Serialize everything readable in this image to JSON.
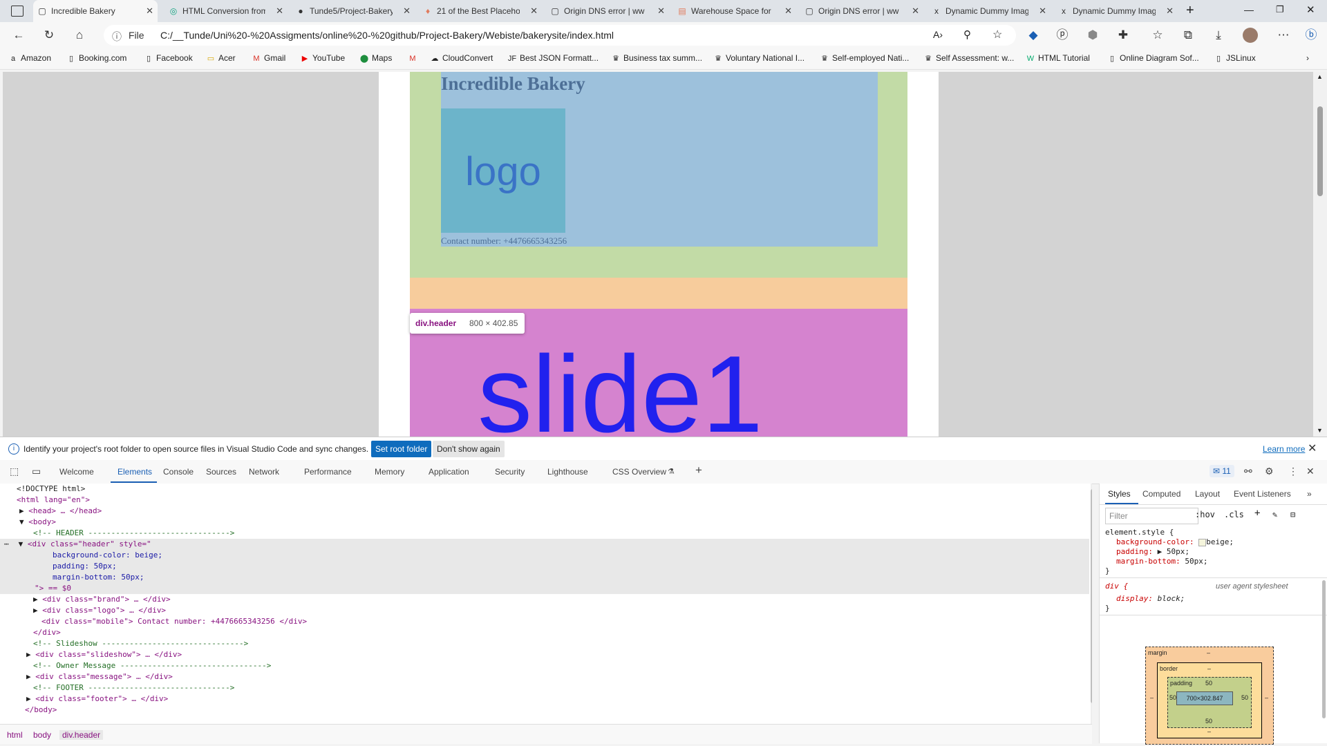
{
  "tabs": [
    {
      "label": "Incredible Bakery",
      "icon": "page-icon",
      "active": true
    },
    {
      "label": "HTML Conversion from",
      "icon": "chatgpt-icon"
    },
    {
      "label": "Tunde5/Project-Bakery",
      "icon": "github-icon"
    },
    {
      "label": "21 of the Best Placeho",
      "icon": "placeholder-site-icon"
    },
    {
      "label": "Origin DNS error | ww",
      "icon": "page-icon"
    },
    {
      "label": "Warehouse Space for",
      "icon": "warehouse-site-icon"
    },
    {
      "label": "Origin DNS error | ww",
      "icon": "page-icon"
    },
    {
      "label": "Dynamic Dummy Imag",
      "icon": "close-mark-icon"
    },
    {
      "label": "Dynamic Dummy Imag",
      "icon": "close-mark-icon"
    }
  ],
  "address": {
    "scheme_label": "File",
    "url": "C:/__Tunde/Uni%20-%20Assigments/online%20-%20github/Project-Bakery/Webiste/bakerysite/index.html"
  },
  "bookmarks": [
    "Amazon",
    "Booking.com",
    "Facebook",
    "Acer",
    "Gmail",
    "YouTube",
    "Maps",
    "CloudConvert",
    "Best JSON Formatt...",
    "Business tax summ...",
    "Voluntary National I...",
    "Self-employed Nati...",
    "Self Assessment: w...",
    "HTML Tutorial",
    "Online Diagram Sof...",
    "JSLinux"
  ],
  "page": {
    "title": "Incredible Bakery",
    "logo_text": "logo",
    "contact": "Contact number: +4476665343256",
    "slide_text": "slide1",
    "tooltip_tag": "div.header",
    "tooltip_size": "800 × 402.85",
    "colors": {
      "margin": "#c2dba6",
      "content": "#9dc1dc",
      "logo": "#6cb4ca",
      "margin_band": "#f7cc9c",
      "slide": "#d583cf"
    }
  },
  "infobar": {
    "message": "Identify your project's root folder to open source files in Visual Studio Code and sync changes.",
    "set_root": "Set root folder",
    "dont_show": "Don't show again",
    "learn_more": "Learn more"
  },
  "devtools": {
    "tabs": [
      "Welcome",
      "Elements",
      "Console",
      "Sources",
      "Network",
      "Performance",
      "Memory",
      "Application",
      "Security",
      "Lighthouse",
      "CSS Overview"
    ],
    "active_tab": "Elements",
    "issues_count": "11",
    "dom": {
      "doctype": "<!DOCTYPE html>",
      "html_open": "<html lang=\"en\">",
      "head": "<head> … </head>",
      "body_open": "<body>",
      "c_header": "<!-- HEADER ------------------------------->",
      "header_open": "<div class=\"header\" style=\"",
      "style1": "background-color: beige;",
      "style2": "padding: 50px;",
      "style3": "margin-bottom: 50px;",
      "style_close": "\"> == $0",
      "brand": "<div class=\"brand\"> … </div>",
      "logo": "<div class=\"logo\"> … </div>",
      "mobile": "<div class=\"mobile\"> Contact number: +4476665343256 </div>",
      "div_close": "</div>",
      "c_slideshow": "<!-- Slideshow ------------------------------->",
      "slideshow": "<div class=\"slideshow\"> … </div>",
      "c_owner": "<!-- Owner Message -------------------------------->",
      "message": "<div class=\"message\"> … </div>",
      "c_footer": "<!-- FOOTER ------------------------------->",
      "footer": "<div class=\"footer\"> … </div>",
      "body_close": "</body>"
    },
    "breadcrumbs": [
      "html",
      "body",
      "div.header"
    ]
  },
  "styles_pane": {
    "tabs": [
      "Styles",
      "Computed",
      "Layout",
      "Event Listeners"
    ],
    "filter_placeholder": "Filter",
    "hov": ":hov",
    "cls": ".cls",
    "element_style_selector": "element.style {",
    "p1": "background-color:",
    "v1": "beige;",
    "p2": "padding:",
    "v2": "▶ 50px;",
    "p3": "margin-bottom:",
    "v3": "50px;",
    "close": "}",
    "div_selector": "div {",
    "ua_label": "user agent stylesheet",
    "p4": "display:",
    "v4": "block;",
    "box_model": {
      "margin_label": "margin",
      "border_label": "border",
      "padding_label": "padding",
      "padding_value": "50",
      "content_size": "700×302.847",
      "dash": "–"
    }
  }
}
